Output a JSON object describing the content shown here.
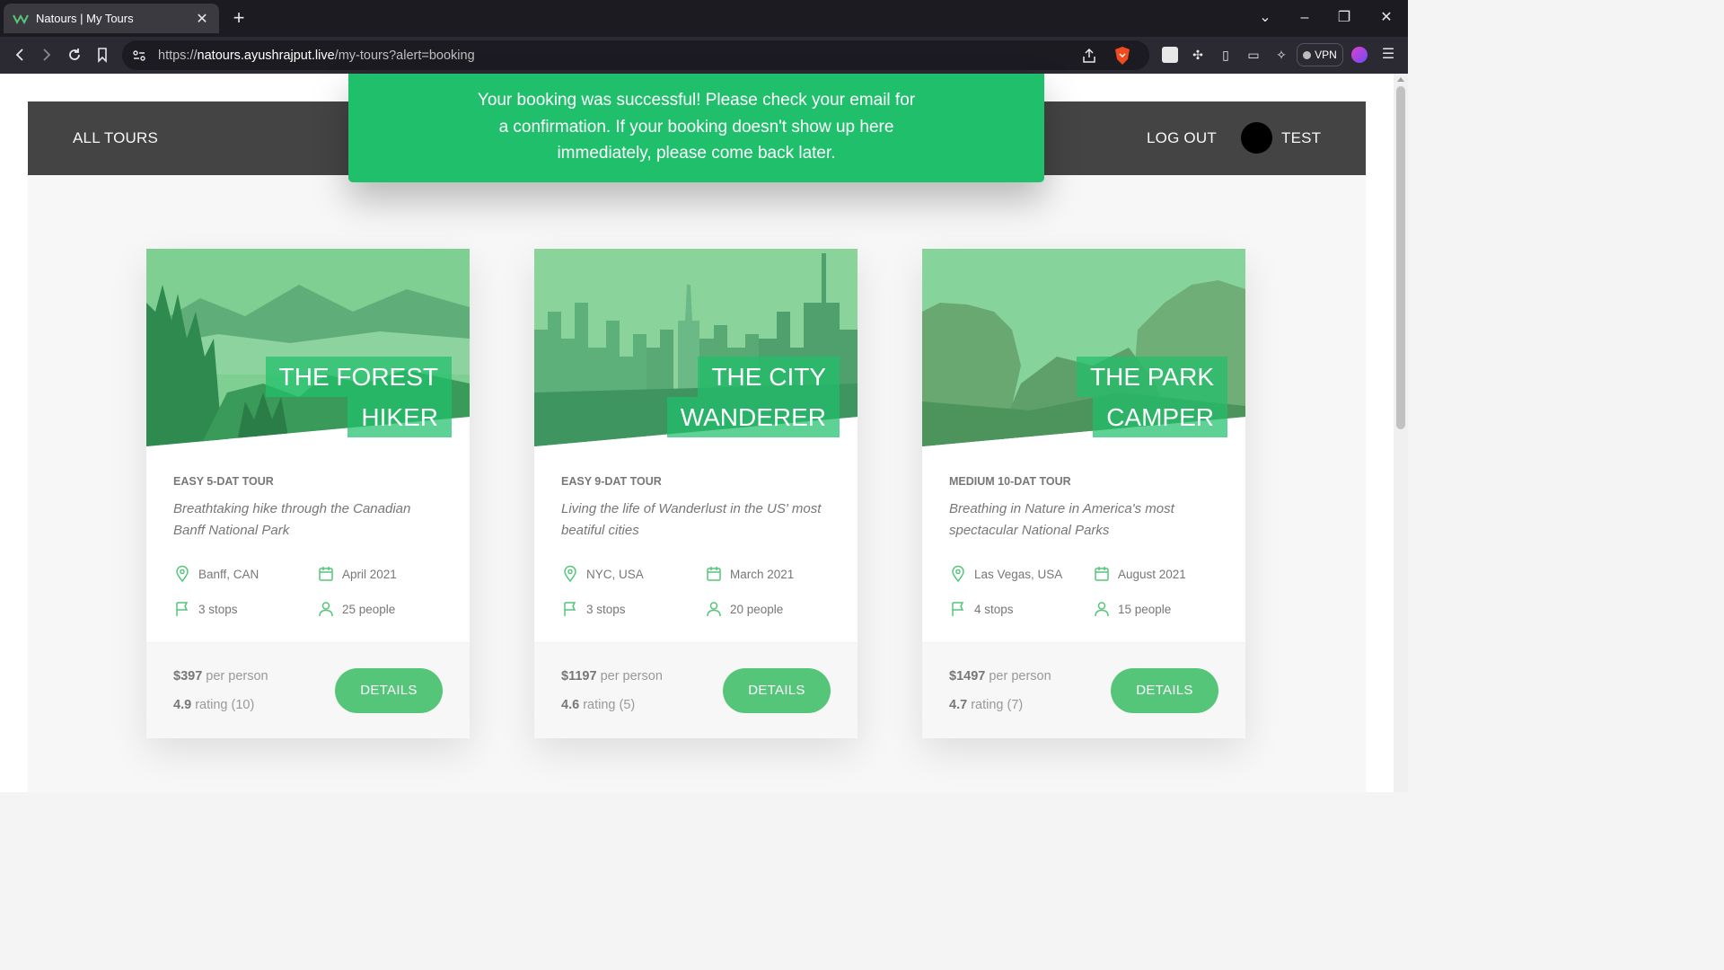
{
  "browser": {
    "tab_title": "Natours | My Tours",
    "url_host": "natours.ayushrajput.live",
    "url_prefix": "https://",
    "url_path": "/my-tours?alert=booking",
    "vpn_label": "VPN"
  },
  "header": {
    "all_tours": "ALL TOURS",
    "logout": "LOG OUT",
    "user_name": "TEST"
  },
  "alert": {
    "message": "Your booking was successful! Please check your email for a confirmation. If your booking doesn't show up here immediately, please come back later."
  },
  "colors": {
    "brand_green": "#55c57a",
    "alert_green": "#20bf6b",
    "header_dark": "#444444"
  },
  "cards": [
    {
      "title_line1": "THE FOREST",
      "title_line2": "HIKER",
      "subheading": "EASY 5-DAT TOUR",
      "summary": "Breathtaking hike through the Canadian Banff National Park",
      "location": "Banff, CAN",
      "date": "April 2021",
      "stops": "3 stops",
      "people": "25 people",
      "price": "$397",
      "price_suffix": "per person",
      "rating": "4.9",
      "rating_suffix": "rating (10)",
      "button": "DETAILS"
    },
    {
      "title_line1": "THE CITY",
      "title_line2": "WANDERER",
      "subheading": "EASY 9-DAT TOUR",
      "summary": "Living the life of Wanderlust in the US' most beatiful cities",
      "location": "NYC, USA",
      "date": "March 2021",
      "stops": "3 stops",
      "people": "20 people",
      "price": "$1197",
      "price_suffix": "per person",
      "rating": "4.6",
      "rating_suffix": "rating (5)",
      "button": "DETAILS"
    },
    {
      "title_line1": "THE PARK",
      "title_line2": "CAMPER",
      "subheading": "MEDIUM 10-DAT TOUR",
      "summary": "Breathing in Nature in America's most spectacular National Parks",
      "location": "Las Vegas, USA",
      "date": "August 2021",
      "stops": "4 stops",
      "people": "15 people",
      "price": "$1497",
      "price_suffix": "per person",
      "rating": "4.7",
      "rating_suffix": "rating (7)",
      "button": "DETAILS"
    }
  ]
}
